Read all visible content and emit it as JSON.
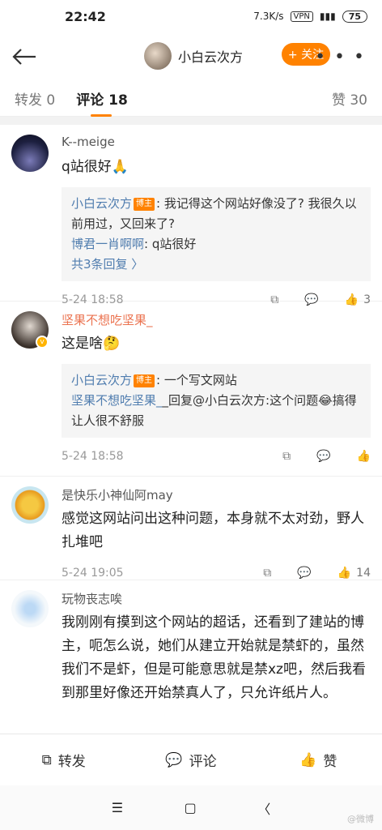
{
  "status": {
    "time": "22:42",
    "net": "7.3K/s",
    "vpn": "VPN",
    "battery": "75"
  },
  "header": {
    "name": "小白云次方",
    "follow": "+ 关注",
    "more": "• • •"
  },
  "tabs": {
    "repost": "转发 0",
    "comment": "评论 18",
    "like": "赞 30"
  },
  "comments": [
    {
      "user": "K--meige",
      "text": "q站很好🙏",
      "replies": [
        {
          "user": "小白云次方",
          "tag": "博主",
          "text": ": 我记得这个网站好像没了? 我很久以前用过，又回来了?"
        },
        {
          "user": "博君一肖啊啊",
          "text": ": q站很好"
        }
      ],
      "more": "共3条回复 〉",
      "time": "5-24 18:58",
      "likes": "3"
    },
    {
      "user": "坚果不想吃坚果_",
      "text": "这是啥🤔",
      "replies": [
        {
          "user": "小白云次方",
          "tag": "博主",
          "text": ": 一个写文网站"
        },
        {
          "user": "坚果不想吃坚果_",
          "text": "回复@小白云次方:这个问题😂搞得让人很不舒服"
        }
      ],
      "time": "5-24 18:58",
      "likes": ""
    },
    {
      "user": "是快乐小神仙阿may",
      "text": "感觉这网站问出这种问题，本身就不太对劲，野人扎堆吧",
      "time": "5-24 19:05",
      "likes": "14"
    },
    {
      "user": "玩物丧志唉",
      "text": "我刚刚有摸到这个网站的超话，还看到了建站的博主，呃怎么说，她们从建立开始就是禁虾的，虽然我们不是虾，但是可能意思就是禁xz吧，然后我看到那里好像还开始禁真人了，只允许纸片人。"
    }
  ],
  "bottom": {
    "repost": "转发",
    "comment": "评论",
    "like": "赞"
  },
  "watermark": "@微博"
}
